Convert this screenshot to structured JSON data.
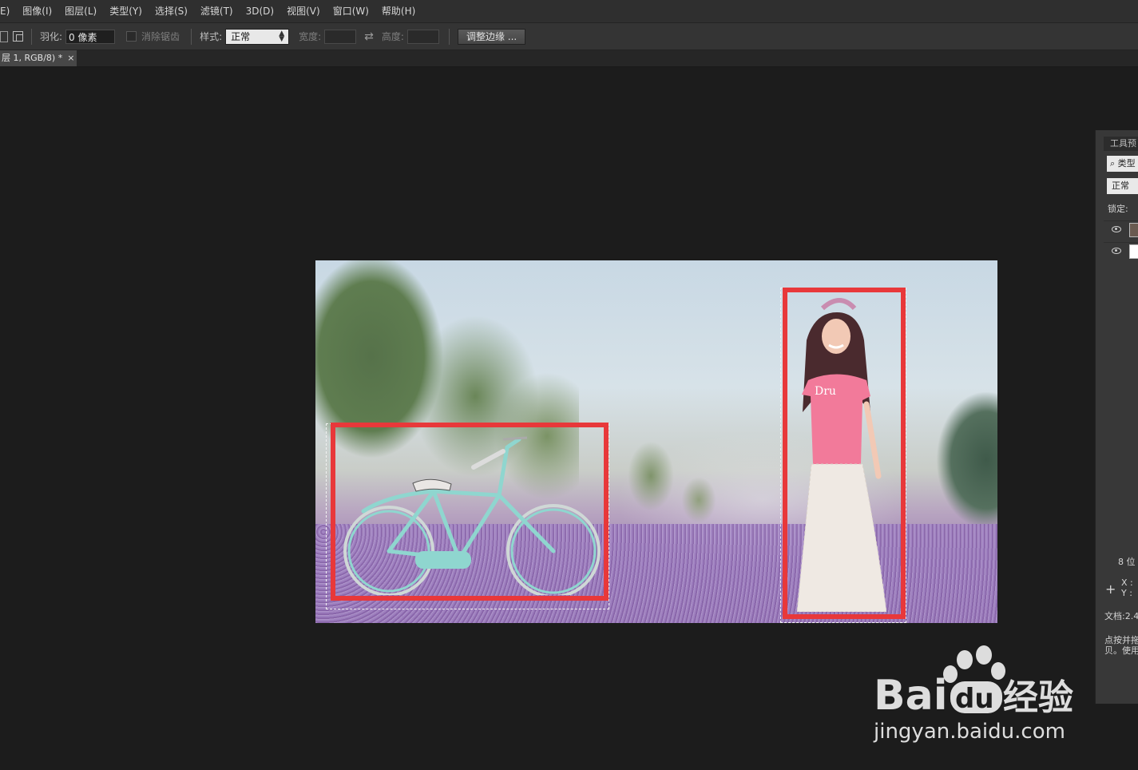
{
  "menu": {
    "items": [
      "E)",
      "图像(I)",
      "图层(L)",
      "类型(Y)",
      "选择(S)",
      "滤镜(T)",
      "3D(D)",
      "视图(V)",
      "窗口(W)",
      "帮助(H)"
    ]
  },
  "options": {
    "feather_label": "羽化:",
    "feather_value": "0 像素",
    "antialias_label": "消除锯齿",
    "style_label": "样式:",
    "style_value": "正常",
    "width_label": "宽度:",
    "height_label": "高度:",
    "refine_edge_label": "调整边缘 ..."
  },
  "document": {
    "tab_title": "层 1, RGB/8) *",
    "tab_close": "×"
  },
  "panel": {
    "header": "工具预",
    "search_text": "类型",
    "blend_mode": "正常",
    "lock_label": "锁定:",
    "bits_label": "8 位",
    "x_label": "X :",
    "y_label": "Y :",
    "doc_label": "文档:2.4",
    "hint_line1": "点按并拖",
    "hint_line2": "贝。使用"
  },
  "watermark": {
    "brand_left": "Bai",
    "brand_du": "du",
    "brand_right": "经验",
    "url": "jingyan.baidu.com"
  },
  "colors": {
    "highlight_red": "#e8383a",
    "menubar_bg": "#2f2f2f",
    "workspace_bg": "#1c1c1c"
  }
}
